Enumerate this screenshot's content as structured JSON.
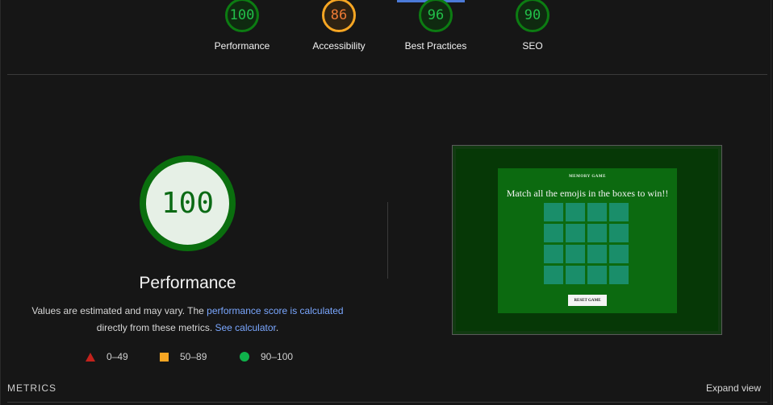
{
  "categories": [
    {
      "score": "100",
      "label": "Performance",
      "rating": "pass"
    },
    {
      "score": "86",
      "label": "Accessibility",
      "rating": "average"
    },
    {
      "score": "96",
      "label": "Best Practices",
      "rating": "pass"
    },
    {
      "score": "90",
      "label": "SEO",
      "rating": "pass"
    }
  ],
  "performance": {
    "score": "100",
    "title": "Performance",
    "desc_prefix": "Values are estimated and may vary. The ",
    "desc_link1": "performance score is calculated",
    "desc_middle": " directly from these metrics. ",
    "desc_link2": "See calculator",
    "desc_suffix": "."
  },
  "legend": {
    "fail": "0–49",
    "average": "50–89",
    "pass": "90–100"
  },
  "preview": {
    "game_title": "MEMORY GAME",
    "game_subtitle": "Match all the emojis in the boxes to win!!",
    "reset_label": "RESET GAME"
  },
  "footer": {
    "metrics_label": "METRICS",
    "expand_label": "Expand view"
  },
  "colors": {
    "pass": "#0c7c12",
    "average": "#f6a623",
    "fail": "#c3221c",
    "link": "#7aa7ff"
  }
}
